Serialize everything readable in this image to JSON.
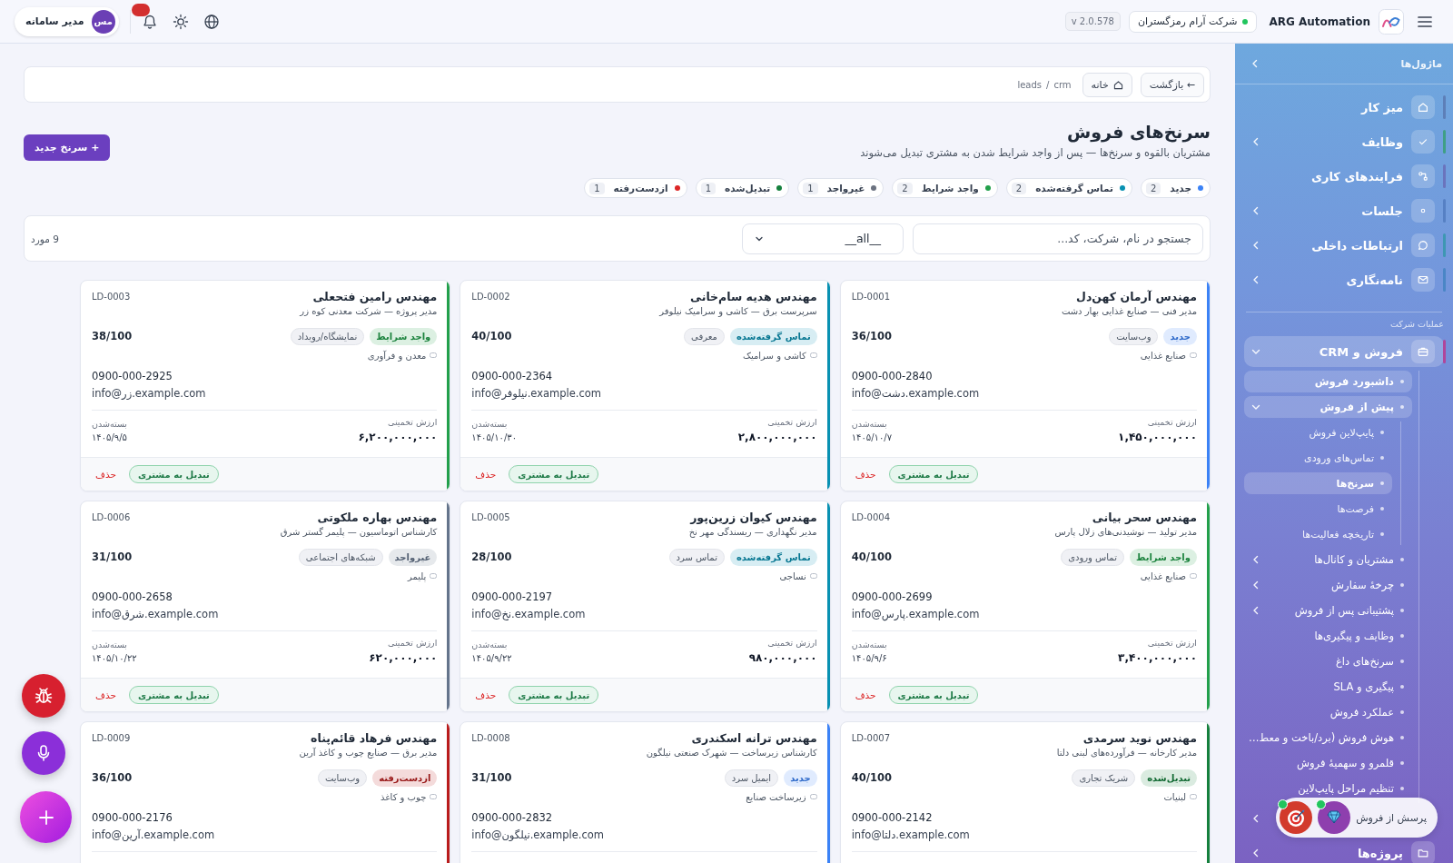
{
  "top_bar": {
    "app_name": "ARG Automation",
    "company": "شرکت آرام رمزگستران",
    "version": "v 2.0.578",
    "notifications_unread": true,
    "user": {
      "initials": "مس",
      "name": "مدیر سامانه"
    }
  },
  "sidebar": {
    "title": "ماژول‌ها",
    "items": [
      {
        "label": "میز کار",
        "color": "#5d7fb8",
        "selected": false
      },
      {
        "label": "وظایف",
        "color": "#3f9f86",
        "selected": false,
        "expanded": false
      },
      {
        "label": "فرایندهای کاری",
        "color": "#6a74bd",
        "selected": false
      },
      {
        "label": "جلسات",
        "color": "#5680c4",
        "selected": false,
        "expanded": false
      },
      {
        "label": "ارتباطات داخلی",
        "color": "#3e97b3",
        "selected": false,
        "expanded": false
      },
      {
        "label": "نامه‌نگاری",
        "color": "#4a86c6",
        "selected": false,
        "expanded": false
      }
    ],
    "sections": [
      {
        "title": "عملیات شرکت",
        "items": [
          {
            "label": "فروش و CRM",
            "color": "#b0469b",
            "selected": true,
            "expanded": true,
            "children": [
              {
                "label": "داشبورد فروش",
                "selected": true
              },
              {
                "label": "پیش از فروش",
                "selected": true,
                "expanded": true,
                "children": [
                  {
                    "label": "پایپ‌لاین فروش",
                    "selected": false
                  },
                  {
                    "label": "تماس‌های ورودی",
                    "selected": false
                  },
                  {
                    "label": "سرنخ‌ها",
                    "selected": true
                  },
                  {
                    "label": "فرصت‌ها",
                    "selected": false
                  },
                  {
                    "label": "تاریخچه فعالیت‌ها",
                    "selected": false
                  }
                ]
              },
              {
                "label": "مشتریان و کانال‌ها",
                "selected": false,
                "expanded": false
              },
              {
                "label": "چرخهٔ سفارش",
                "selected": false,
                "expanded": false
              },
              {
                "label": "پشتیبانی پس از فروش",
                "selected": false,
                "expanded": false
              },
              {
                "label": "وظایف و پیگیری‌ها",
                "selected": false
              },
              {
                "label": "سرنخ‌های داغ",
                "selected": false
              },
              {
                "label": "پیگیری و SLA",
                "selected": false
              },
              {
                "label": "عملکرد فروش",
                "selected": false
              },
              {
                "label": "هوش فروش (برد/باخت و معط…",
                "selected": false
              },
              {
                "label": "قلمرو و سهمیهٔ فروش",
                "selected": false
              },
              {
                "label": "تنظیم مراحل پایپ‌لاین",
                "selected": false
              }
            ]
          },
          {
            "expanded": false
          },
          {
            "label": "پروژه‌ها",
            "selected": false,
            "expanded": false
          }
        ]
      }
    ]
  },
  "ask_widget": {
    "label": "پرسش از فروش",
    "assistants": [
      {
        "online": true
      },
      {
        "online": true
      }
    ]
  },
  "breadcrumb": {
    "back": "← بازگشت",
    "home": "خانه",
    "path": [
      "crm",
      "leads"
    ],
    "separator": "/"
  },
  "page": {
    "title": "سرنخ‌های فروش",
    "subtitle": "مشتریان بالقوه و سرنخ‌ها — پس از واجد شرایط شدن به مشتری تبدیل می‌شوند",
    "new_button": "+ سرنخ جدید"
  },
  "status_summary": [
    {
      "label": "جدید",
      "count": "2",
      "color": "#3b82f6"
    },
    {
      "label": "تماس گرفته‌شده",
      "count": "2",
      "color": "#0891b2"
    },
    {
      "label": "واجد شرایط",
      "count": "2",
      "color": "#22a04b"
    },
    {
      "label": "غیرواجد",
      "count": "1",
      "color": "#6b7280"
    },
    {
      "label": "تبدیل‌شده",
      "count": "1",
      "color": "#15803d"
    },
    {
      "label": "ازدست‌رفته",
      "count": "1",
      "color": "#dc2626"
    }
  ],
  "filters": {
    "search": {
      "placeholder": "جستجو در نام، شرکت، کد..."
    },
    "status_select": {
      "value": "__all__"
    },
    "result_count": "9 مورد"
  },
  "cards": [
    {
      "code": "LD-0001",
      "name": "مهندس آرمان کهن‌دل",
      "role": "مدیر فنی — صنایع غذایی بهار دشت",
      "status": {
        "label": "جدید",
        "color": "#3b82f6"
      },
      "source": "وب‌سایت",
      "industry": "صنایع غذایی",
      "score": "36/100",
      "phone": "0900-000-2840",
      "email": "info@دشت.example.com",
      "estimate_label": "ارزش تخمینی",
      "estimate": "۱,۴۵۰,۰۰۰,۰۰۰",
      "close_label": "بسته‌شدن",
      "close_date": "۱۴۰۵/۱۰/۷",
      "convert": "تبدیل به مشتری",
      "delete": "حذف"
    },
    {
      "code": "LD-0002",
      "name": "مهندس هدیه سام‌خانی",
      "role": "سرپرست برق — کاشی و سرامیک نیلوفر",
      "status": {
        "label": "تماس گرفته‌شده",
        "color": "#0891b2"
      },
      "source": "معرفی",
      "industry": "کاشی و سرامیک",
      "score": "40/100",
      "phone": "0900-000-2364",
      "email": "info@نیلوفر.example.com",
      "estimate_label": "ارزش تخمینی",
      "estimate": "۲,۸۰۰,۰۰۰,۰۰۰",
      "close_label": "بسته‌شدن",
      "close_date": "۱۴۰۵/۱۰/۳۰",
      "convert": "تبدیل به مشتری",
      "delete": "حذف"
    },
    {
      "code": "LD-0003",
      "name": "مهندس رامین فتحعلی",
      "role": "مدیر پروژه — شرکت معدنی کوه زر",
      "status": {
        "label": "واجد شرایط",
        "color": "#22a04b"
      },
      "source": "نمایشگاه/رویداد",
      "industry": "معدن و فرآوری",
      "score": "38/100",
      "phone": "0900-000-2925",
      "email": "info@زر.example.com",
      "estimate_label": "ارزش تخمینی",
      "estimate": "۶,۲۰۰,۰۰۰,۰۰۰",
      "close_label": "بسته‌شدن",
      "close_date": "۱۴۰۵/۹/۵",
      "convert": "تبدیل به مشتری",
      "delete": "حذف"
    },
    {
      "code": "LD-0004",
      "name": "مهندس سحر بیانی",
      "role": "مدیر تولید — نوشیدنی‌های زلال پارس",
      "status": {
        "label": "واجد شرایط",
        "color": "#22a04b"
      },
      "source": "تماس ورودی",
      "industry": "صنایع غذایی",
      "score": "40/100",
      "phone": "0900-000-2699",
      "email": "info@پارس.example.com",
      "estimate_label": "ارزش تخمینی",
      "estimate": "۳,۴۰۰,۰۰۰,۰۰۰",
      "close_label": "بسته‌شدن",
      "close_date": "۱۴۰۵/۹/۶",
      "convert": "تبدیل به مشتری",
      "delete": "حذف"
    },
    {
      "code": "LD-0005",
      "name": "مهندس کیوان زرین‌پور",
      "role": "مدیر نگهداری — ریسندگی مهر نخ",
      "status": {
        "label": "تماس گرفته‌شده",
        "color": "#0891b2"
      },
      "source": "تماس سرد",
      "industry": "نساجی",
      "score": "28/100",
      "phone": "0900-000-2197",
      "email": "info@نخ.example.com",
      "estimate_label": "ارزش تخمینی",
      "estimate": "۹۸۰,۰۰۰,۰۰۰",
      "close_label": "بسته‌شدن",
      "close_date": "۱۴۰۵/۹/۲۲",
      "convert": "تبدیل به مشتری",
      "delete": "حذف"
    },
    {
      "code": "LD-0006",
      "name": "مهندس بهاره ملکوتی",
      "role": "کارشناس اتوماسیون — پلیمر گستر شرق",
      "status": {
        "label": "غیرواجد",
        "color": "#64748b"
      },
      "source": "شبکه‌های اجتماعی",
      "industry": "پلیمر",
      "score": "31/100",
      "phone": "0900-000-2658",
      "email": "info@شرق.example.com",
      "estimate_label": "ارزش تخمینی",
      "estimate": "۶۲۰,۰۰۰,۰۰۰",
      "close_label": "بسته‌شدن",
      "close_date": "۱۴۰۵/۱۰/۲۲",
      "convert": "تبدیل به مشتری",
      "delete": "حذف"
    },
    {
      "code": "LD-0007",
      "name": "مهندس نوید سرمدی",
      "role": "مدیر کارخانه — فرآورده‌های لبنی دلتا",
      "status": {
        "label": "تبدیل‌شده",
        "color": "#15803d"
      },
      "source": "شریک تجاری",
      "industry": "لبنیات",
      "score": "40/100",
      "phone": "0900-000-2142",
      "email": "info@دلتا.example.com"
    },
    {
      "code": "LD-0008",
      "name": "مهندس ترانه اسکندری",
      "role": "کارشناس زیرساخت — شهرک صنعتی نیلگون",
      "status": {
        "label": "جدید",
        "color": "#3b82f6"
      },
      "source": "ایمیل سرد",
      "industry": "زیرساخت صنایع",
      "score": "31/100",
      "phone": "0900-000-2832",
      "email": "info@نیلگون.example.com"
    },
    {
      "code": "LD-0009",
      "name": "مهندس فرهاد قائم‌پناه",
      "role": "مدیر برق — صنایع چوب و کاغذ آرین",
      "status": {
        "label": "ازدست‌رفته",
        "color": "#b91c1c"
      },
      "source": "وب‌سایت",
      "industry": "چوب و کاغذ",
      "score": "36/100",
      "phone": "0900-000-2176",
      "email": "info@آرین.example.com"
    }
  ]
}
